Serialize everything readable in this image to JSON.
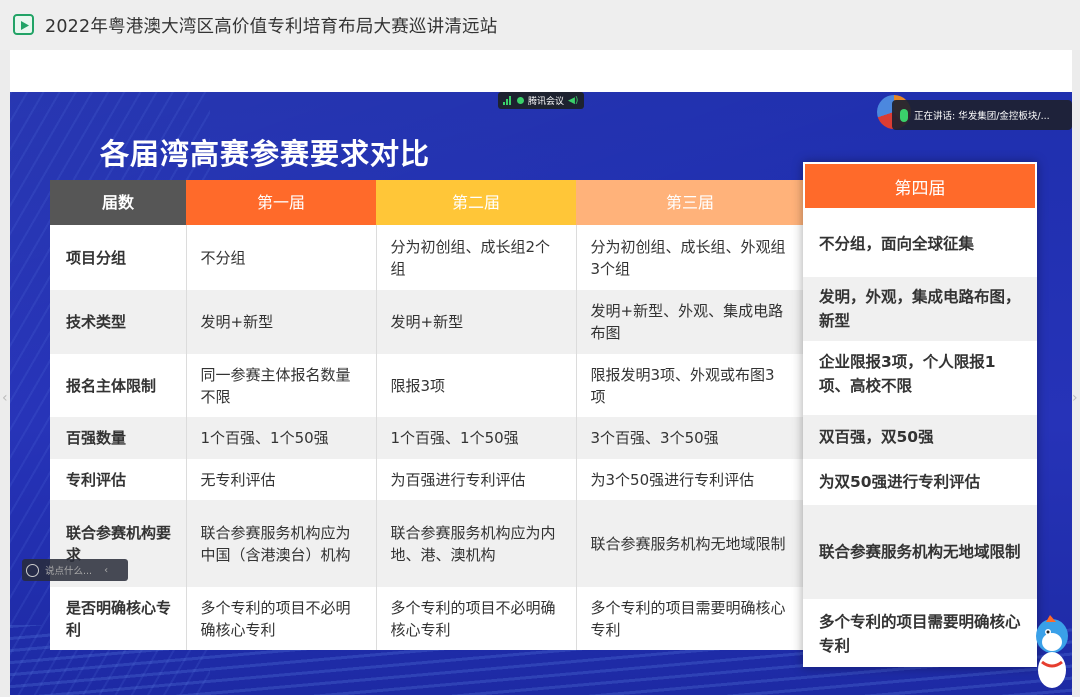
{
  "window": {
    "title": "2022年粤港澳大湾区高价值专利培育布局大赛巡讲清远站"
  },
  "meeting": {
    "app_label": "腾讯会议",
    "speaking": "正在讲话: 华发集团/金控板块/..."
  },
  "chat": {
    "placeholder": "说点什么..."
  },
  "slide": {
    "heading": "各届湾高赛参赛要求对比",
    "columns": [
      "届数",
      "第一届",
      "第二届",
      "第三届",
      "第四届"
    ],
    "rows": [
      {
        "label": "项目分组",
        "c1": "不分组",
        "c2": "分为初创组、成长组2个组",
        "c3": "分为初创组、成长组、外观组3个组",
        "c4": "不分组，面向全球征集"
      },
      {
        "label": "技术类型",
        "c1": "发明+新型",
        "c2": "发明+新型",
        "c3": "发明+新型、外观、集成电路布图",
        "c4": "发明，外观，集成电路布图，新型"
      },
      {
        "label": "报名主体限制",
        "c1": "同一参赛主体报名数量不限",
        "c2": "限报3项",
        "c3": "限报发明3项、外观或布图3项",
        "c4": "企业限报3项，个人限报1项、高校不限"
      },
      {
        "label": "百强数量",
        "c1": "1个百强、1个50强",
        "c2": "1个百强、1个50强",
        "c3": "3个百强、3个50强",
        "c4": "双百强，双50强"
      },
      {
        "label": "专利评估",
        "c1": "无专利评估",
        "c2": "为百强进行专利评估",
        "c3": "为3个50强进行专利评估",
        "c4": "为双50强进行专利评估"
      },
      {
        "label": "联合参赛机构要求",
        "c1": "联合参赛服务机构应为中国（含港澳台）机构",
        "c2": "联合参赛服务机构应为内地、港、澳机构",
        "c3": "联合参赛服务机构无地域限制",
        "c4": "联合参赛服务机构无地域限制"
      },
      {
        "label": "是否明确核心专利",
        "c1": "多个专利的项目不必明确核心专利",
        "c2": "多个专利的项目不必明确核心专利",
        "c3": "多个专利的项目需要明确核心专利",
        "c4": "多个专利的项目需要明确核心专利"
      }
    ]
  },
  "colors": {
    "accent_green": "#21a366",
    "header_gray": "#565656",
    "orange": "#ff6a2a",
    "yellow": "#ffc638",
    "peach": "#ffb27a",
    "slide_blue": "#2633b8"
  }
}
